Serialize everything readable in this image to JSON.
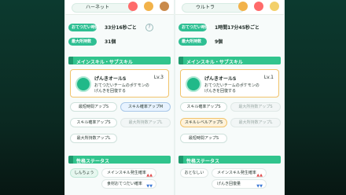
{
  "left_panel": {
    "top": {
      "name": "ハーネット"
    },
    "rows": [
      {
        "label": "おてつだい時間",
        "value": "33分16秒ごと"
      },
      {
        "label": "最大所持数",
        "value": "31個"
      }
    ],
    "section_main_skill": "メインスキル・サブスキル",
    "skill_card": {
      "title": "げんきオールS",
      "level": "Lv.3",
      "desc1": "おてつだいチームのポケモンの",
      "desc2": "げんきを回復する"
    },
    "buttons": [
      {
        "label": "最短時間アップS",
        "state": "normal"
      },
      {
        "label": "スキル確率アップM",
        "state": "active"
      },
      {
        "label": "スキル確率アップS",
        "state": "normal"
      },
      {
        "label": "最大所持数アップL",
        "state": "dim"
      },
      {
        "label": "最大所持数アップL",
        "state": "normal"
      }
    ],
    "section_personality": "性格ステータス",
    "personality": {
      "name": "しんちょう",
      "line1": "メインスキル発生確率",
      "line2": "食材おてつだい確率"
    }
  },
  "right_panel": {
    "top": {
      "name": "ウルトラ"
    },
    "rows": [
      {
        "label": "おてつだい時間",
        "value": "1時間17分45秒ごと"
      },
      {
        "label": "最大所持数",
        "value": "9個"
      }
    ],
    "section_main_skill": "メインスキル・サブスキル",
    "skill_card": {
      "title": "げんきオールS",
      "level": "Lv.1",
      "desc1": "おてつだいチームのポケモンの",
      "desc2": "げんきを回復する"
    },
    "buttons": [
      {
        "label": "スキル確率アップS",
        "state": "normal"
      },
      {
        "label": "最大所持数アップS",
        "state": "dim"
      },
      {
        "label": "スキルレベルアップS",
        "state": "orange"
      },
      {
        "label": "最大所持数アップL",
        "state": "dim"
      },
      {
        "label": "最短時間アップS",
        "state": "normal"
      }
    ],
    "section_personality": "性格ステータス",
    "personality": {
      "name": "おとなしい",
      "line1": "メインスキル発生確率",
      "line2": "げんき回復量"
    }
  }
}
